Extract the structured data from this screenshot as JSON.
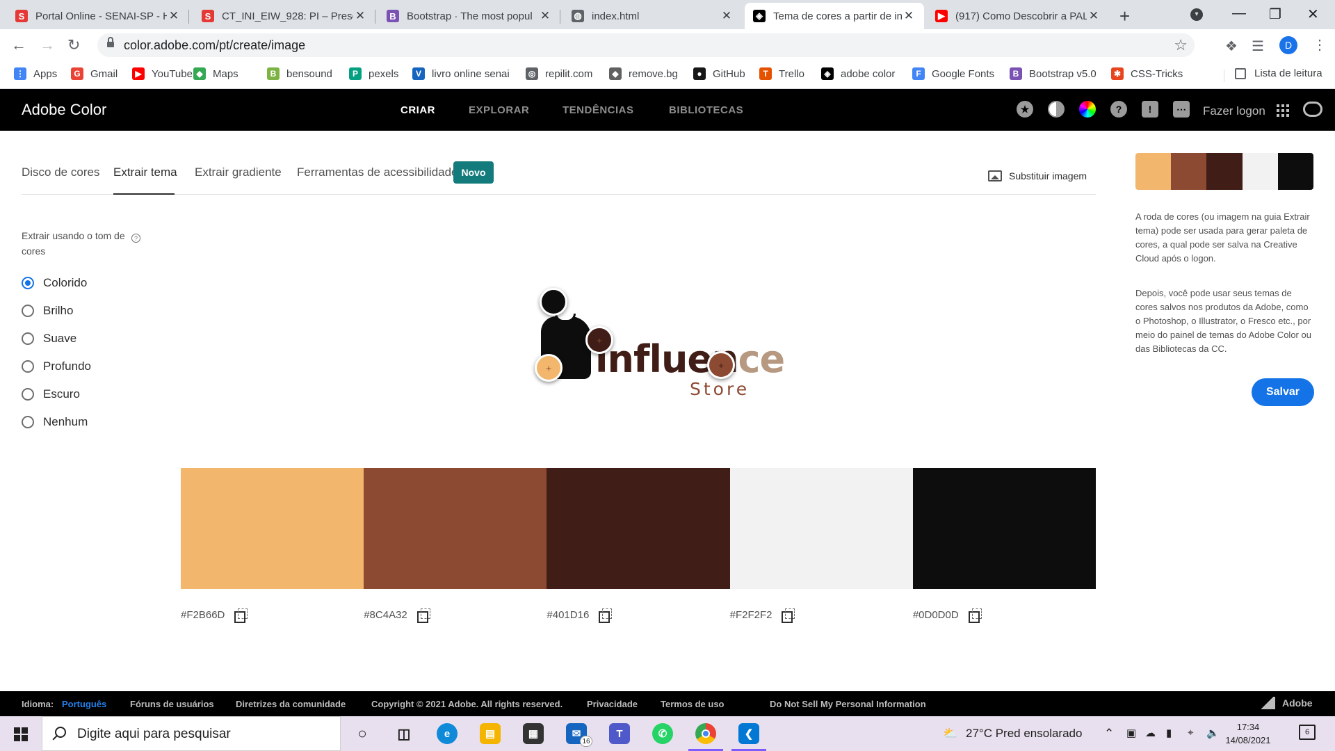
{
  "browser": {
    "tabs": [
      {
        "title": "Portal Online - SENAI-SP - H",
        "icon": "senai-icon",
        "color": "#e53935",
        "glyph": "S"
      },
      {
        "title": "CT_INI_EIW_928: PI – Presen",
        "icon": "senai-icon",
        "color": "#e53935",
        "glyph": "S"
      },
      {
        "title": "Bootstrap · The most popul",
        "icon": "bootstrap-icon",
        "color": "#7952b3",
        "glyph": "B"
      },
      {
        "title": "index.html",
        "icon": "globe-icon",
        "color": "#5f6368",
        "glyph": "◍"
      },
      {
        "title": "Tema de cores a partir de in",
        "icon": "adobe-color-icon",
        "color": "#000000",
        "glyph": "◈"
      },
      {
        "title": "(917) Como Descobrir a PAL",
        "icon": "youtube-icon",
        "color": "#ff0000",
        "glyph": "▶"
      }
    ],
    "new_tab": "+",
    "url": "color.adobe.com/pt/create/image",
    "profile_initial": "D",
    "bookmarks": [
      {
        "label": "Apps",
        "icon": "apps-grid-icon",
        "color": "#4285f4",
        "glyph": "⋮"
      },
      {
        "label": "Gmail",
        "icon": "google-icon",
        "color": "#ea4335",
        "glyph": "G"
      },
      {
        "label": "YouTube",
        "icon": "youtube-icon",
        "color": "#ff0000",
        "glyph": "▶"
      },
      {
        "label": "Maps",
        "icon": "maps-icon",
        "color": "#34a853",
        "glyph": "◆"
      },
      {
        "label": "bensound",
        "icon": "bensound-icon",
        "color": "#7cb342",
        "glyph": "B"
      },
      {
        "label": "pexels",
        "icon": "pexels-icon",
        "color": "#05a081",
        "glyph": "P"
      },
      {
        "label": "livro online senai",
        "icon": "book-icon",
        "color": "#1565c0",
        "glyph": "V"
      },
      {
        "label": "repilit.com",
        "icon": "replit-icon",
        "color": "#5f6368",
        "glyph": "◎"
      },
      {
        "label": "remove.bg",
        "icon": "removebg-icon",
        "color": "#616161",
        "glyph": "◆"
      },
      {
        "label": "GitHub",
        "icon": "github-icon",
        "color": "#181717",
        "glyph": "●"
      },
      {
        "label": "Trello",
        "icon": "trello-icon",
        "color": "#e65100",
        "glyph": "T"
      },
      {
        "label": "adobe color",
        "icon": "adobe-color-icon",
        "color": "#000000",
        "glyph": "◈"
      },
      {
        "label": "Google Fonts",
        "icon": "google-fonts-icon",
        "color": "#4285f4",
        "glyph": "F"
      },
      {
        "label": "Bootstrap v5.0",
        "icon": "bootstrap-icon",
        "color": "#7952b3",
        "glyph": "B"
      },
      {
        "label": "CSS-Tricks",
        "icon": "css-tricks-icon",
        "color": "#e8451e",
        "glyph": "✱"
      }
    ],
    "reading_list": "Lista de leitura"
  },
  "app": {
    "brand": "Adobe Color",
    "nav": [
      {
        "label": "CRIAR",
        "active": true
      },
      {
        "label": "EXPLORAR",
        "active": false
      },
      {
        "label": "TENDÊNCIAS",
        "active": false
      },
      {
        "label": "BIBLIOTECAS",
        "active": false
      }
    ],
    "login": "Fazer logon"
  },
  "subtabs": [
    {
      "label": "Disco de cores",
      "active": false
    },
    {
      "label": "Extrair tema",
      "active": true
    },
    {
      "label": "Extrair gradiente",
      "active": false
    },
    {
      "label": "Ferramentas de acessibilidade",
      "active": false
    }
  ],
  "badge_new": "Novo",
  "replace_image": "Substituir imagem",
  "mood": {
    "label": "Extrair usando o tom de cores",
    "options": [
      {
        "label": "Colorido",
        "selected": true
      },
      {
        "label": "Brilho",
        "selected": false
      },
      {
        "label": "Suave",
        "selected": false
      },
      {
        "label": "Profundo",
        "selected": false
      },
      {
        "label": "Escuro",
        "selected": false
      },
      {
        "label": "Nenhum",
        "selected": false
      }
    ]
  },
  "image": {
    "word": "influen",
    "word_tail": "ce",
    "subword": "Store"
  },
  "swatches": [
    {
      "hex": "#F2B66D",
      "color": "#F2B66D"
    },
    {
      "hex": "#8C4A32",
      "color": "#8C4A32"
    },
    {
      "hex": "#401D16",
      "color": "#401D16"
    },
    {
      "hex": "#F2F2F2",
      "color": "#F2F2F2"
    },
    {
      "hex": "#0D0D0D",
      "color": "#0D0D0D"
    }
  ],
  "right_panel": {
    "para1": "A roda de cores (ou imagem na guia Extrair tema) pode ser usada para gerar paleta de cores, a qual pode ser salva na Creative Cloud após o logon.",
    "para2": "Depois, você pode usar seus temas de cores salvos nos produtos da Adobe, como o Photoshop, o Illustrator, o Fresco etc., por meio do painel de temas do Adobe Color ou das Bibliotecas da CC.",
    "save": "Salvar"
  },
  "footer": {
    "lang_label": "Idioma:",
    "lang_value": "Português",
    "links": [
      "Fóruns de usuários",
      "Diretrizes da comunidade",
      "Copyright © 2021 Adobe. All rights reserved.",
      "Privacidade",
      "Termos de uso",
      "Do Not Sell My Personal Information"
    ],
    "adobe": "Adobe"
  },
  "taskbar": {
    "search_placeholder": "Digite aqui para pesquisar",
    "mail_badge": "16",
    "weather": "27°C  Pred ensolarado",
    "time": "17:34",
    "date": "14/08/2021",
    "notifications": "6"
  }
}
